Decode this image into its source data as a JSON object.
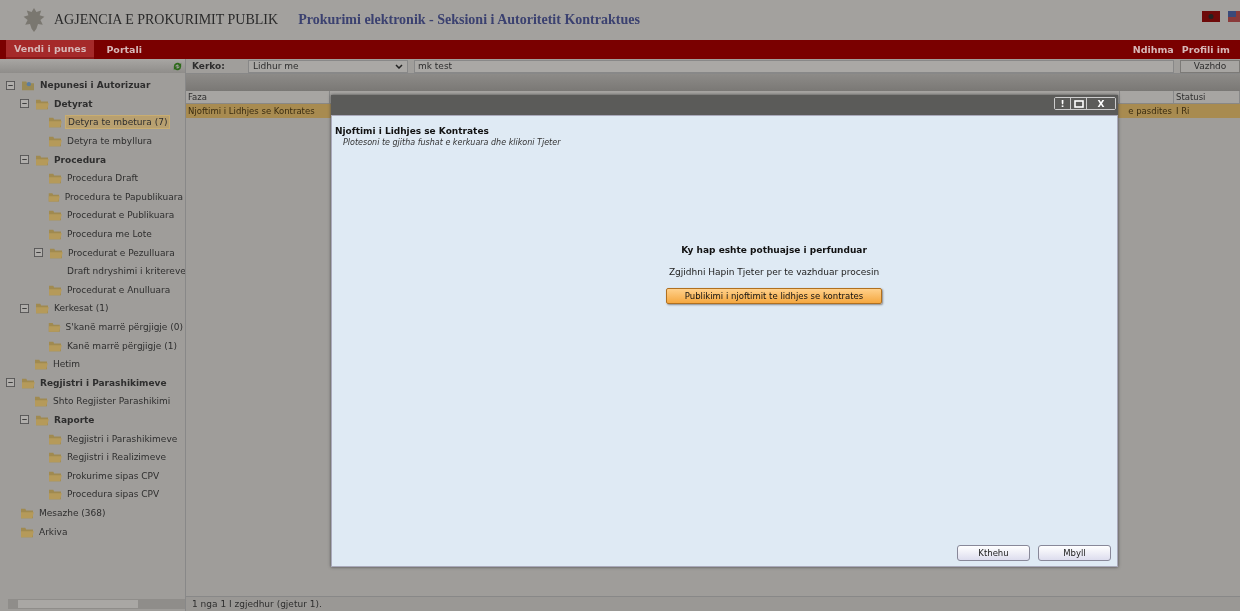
{
  "header": {
    "agency": "AGJENCIA E PROKURIMIT PUBLIK",
    "subtitle": "Prokurimi elektronik - Seksioni i Autoritetit Kontraktues"
  },
  "nav": {
    "tabs": [
      {
        "label": "Vendi i punes",
        "selected": true
      },
      {
        "label": "Portali",
        "selected": false
      }
    ],
    "links": [
      "Ndihma",
      "Profili im"
    ]
  },
  "search": {
    "label": "Kerko:",
    "filter": "Lidhur me",
    "value": "mk test",
    "button": "Vazhdo"
  },
  "sidebar": {
    "items": [
      {
        "label": "Nepunesi i Autorizuar",
        "kind": "user",
        "expanded": true,
        "selected": false,
        "children": [
          {
            "label": "Detyrat",
            "kind": "group",
            "expanded": true,
            "selected": false,
            "children": [
              {
                "label": "Detyra te mbetura (7)",
                "kind": "folder",
                "selected": true
              },
              {
                "label": "Detyra te mbyllura",
                "kind": "folder",
                "selected": false
              }
            ]
          },
          {
            "label": "Procedura",
            "kind": "group",
            "expanded": true,
            "selected": false,
            "children": [
              {
                "label": "Procedura Draft",
                "kind": "folder",
                "selected": false
              },
              {
                "label": "Procedura te Papublikuara",
                "kind": "folder",
                "selected": false
              },
              {
                "label": "Procedurat e Publikuara",
                "kind": "folder",
                "selected": false
              },
              {
                "label": "Procedura me Lote",
                "kind": "folder",
                "selected": false
              },
              {
                "label": "Procedurat e Pezulluara",
                "kind": "folder",
                "expanded": true,
                "selected": false,
                "children": [
                  {
                    "label": "Draft ndryshimi i kritereve",
                    "kind": "folder",
                    "selected": false
                  }
                ]
              },
              {
                "label": "Procedurat e Anulluara",
                "kind": "folder",
                "selected": false
              }
            ]
          },
          {
            "label": "Kerkesat (1)",
            "kind": "folder",
            "expanded": true,
            "selected": false,
            "children": [
              {
                "label": "S'kanë marrë përgjigje (0)",
                "kind": "folder",
                "selected": false
              },
              {
                "label": "Kanë marrë përgjigje (1)",
                "kind": "folder",
                "selected": false
              }
            ]
          },
          {
            "label": "Hetim",
            "kind": "folder",
            "selected": false
          }
        ]
      },
      {
        "label": "Regjistri i Parashikimeve",
        "kind": "group",
        "expanded": true,
        "selected": false,
        "children": [
          {
            "label": "Shto Regjister Parashikimi",
            "kind": "folder",
            "selected": false
          },
          {
            "label": "Raporte",
            "kind": "group",
            "expanded": true,
            "selected": false,
            "children": [
              {
                "label": "Regjistri i Parashikimeve",
                "kind": "folder",
                "selected": false
              },
              {
                "label": "Regjistri i Realizimeve",
                "kind": "folder",
                "selected": false
              },
              {
                "label": "Prokurime sipas CPV",
                "kind": "folder",
                "selected": false
              },
              {
                "label": "Procedura sipas CPV",
                "kind": "folder",
                "selected": false
              }
            ]
          }
        ]
      },
      {
        "label": "Mesazhe (368)",
        "kind": "folder",
        "selected": false
      },
      {
        "label": "Arkiva",
        "kind": "folder",
        "selected": false
      }
    ]
  },
  "table": {
    "columns": [
      "Faza",
      "",
      "",
      "Statusi"
    ],
    "rows": [
      {
        "cells": [
          "Njoftimi i Lidhjes se Kontrates",
          "",
          "e pasdites",
          "I Ri"
        ],
        "selected": true
      }
    ]
  },
  "status_bar": "1 nga 1 I zgjedhur (gjetur 1).",
  "dialog": {
    "window_buttons": [
      "!",
      "X"
    ],
    "title": "Njoftimi i Lidhjes se Kontrates",
    "instruction": "Plotesoni te gjitha fushat e kerkuara dhe klikoni Tjeter",
    "heading": "Ky hap eshte pothuajse i perfunduar",
    "message": "Zgjidhni Hapin Tjeter per te vazhduar procesin",
    "action": "Publikimi i njoftimit te lidhjes se kontrates",
    "buttons": [
      "Kthehu",
      "Mbyll"
    ]
  }
}
